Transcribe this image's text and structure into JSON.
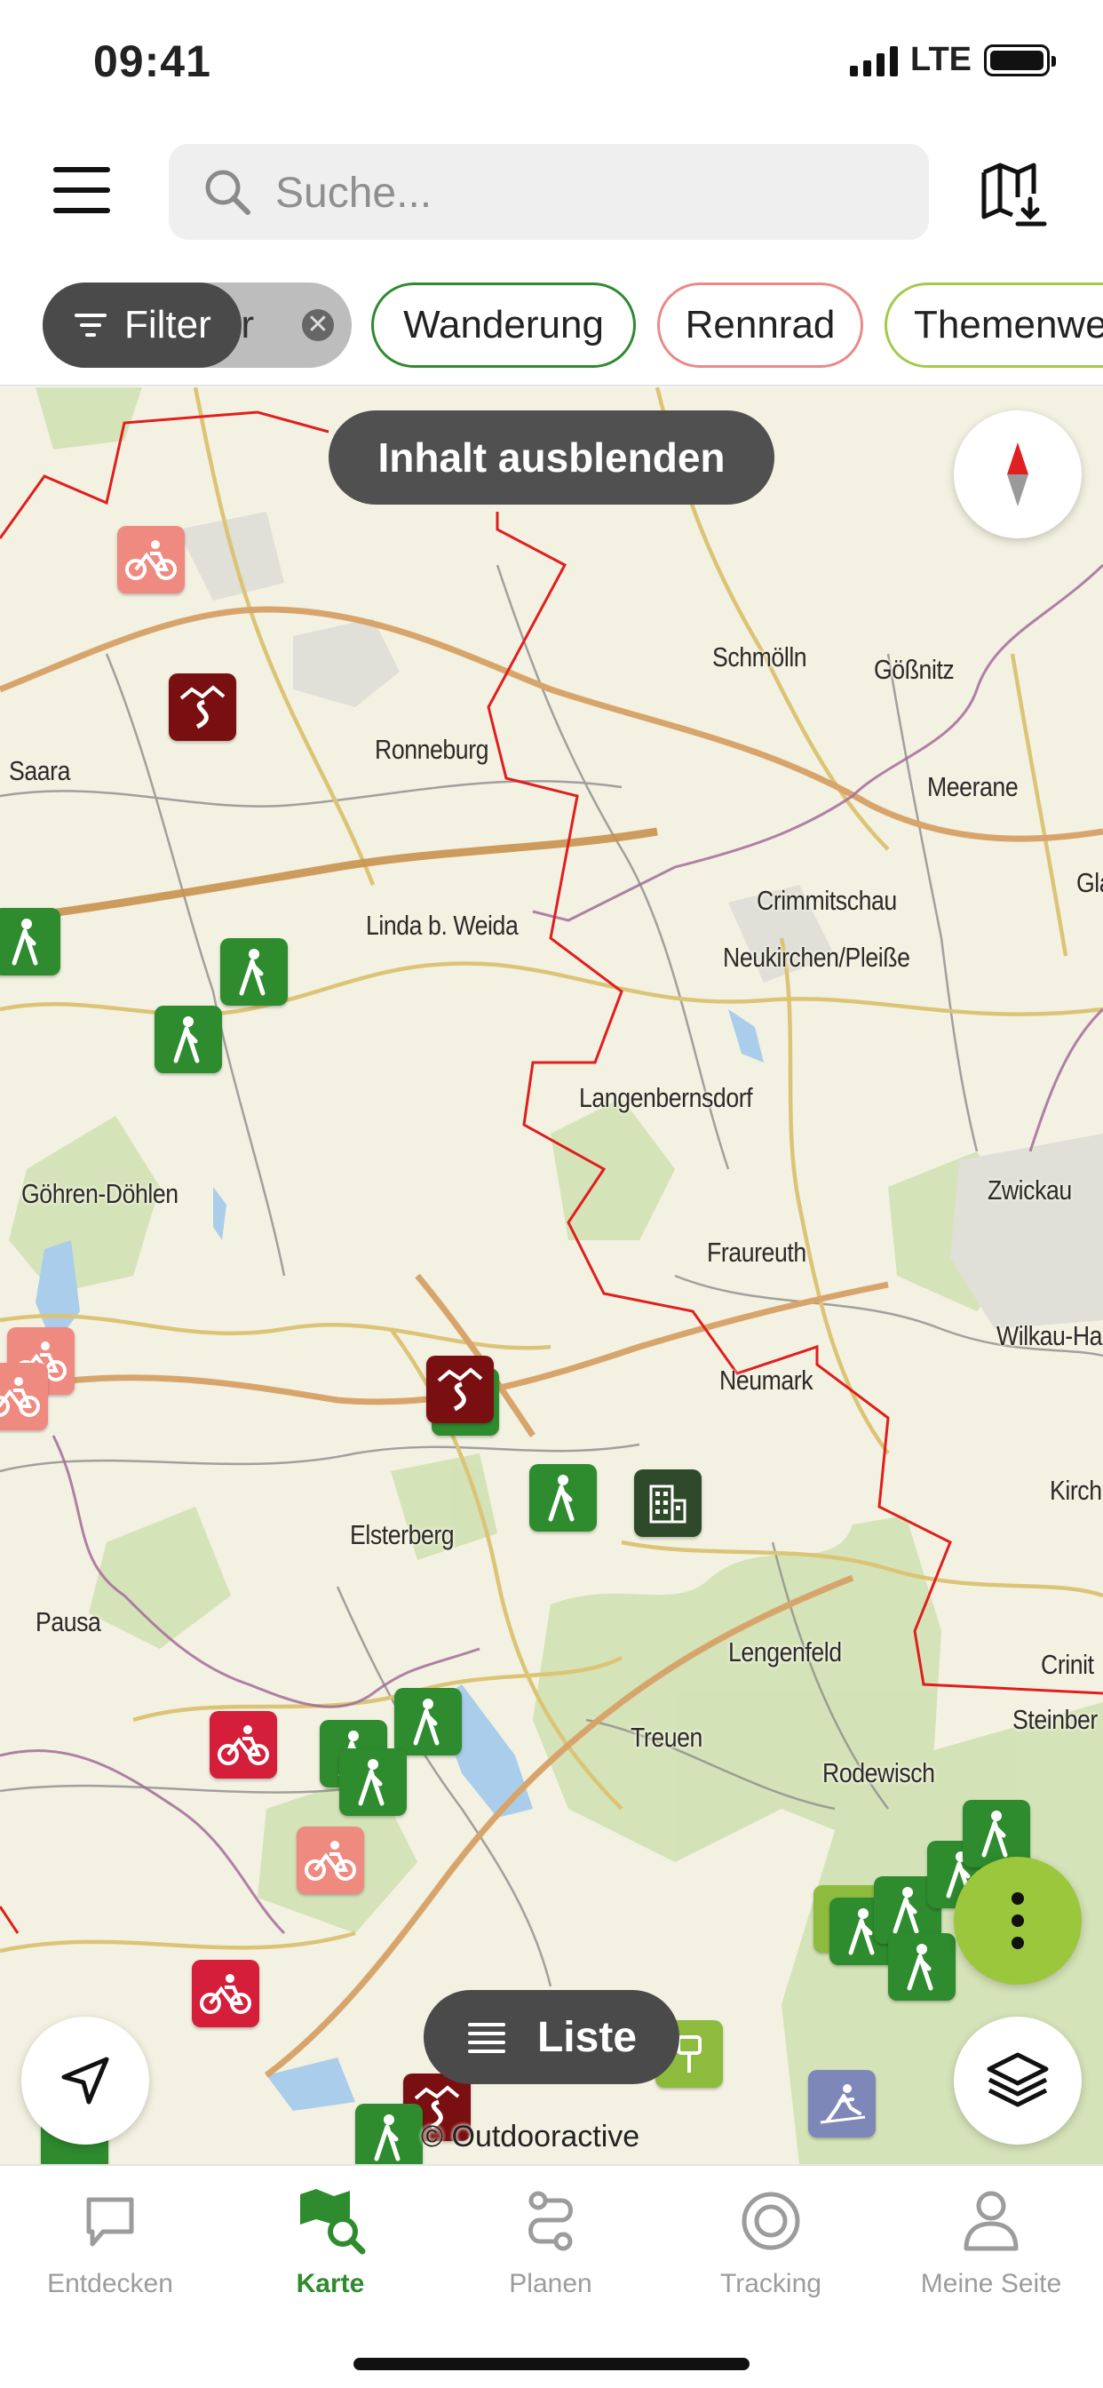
{
  "status_bar": {
    "time": "09:41",
    "network": "LTE"
  },
  "header": {
    "search_placeholder": "Suche..."
  },
  "filters": {
    "filter_label": "Filter",
    "tour_chip_label": "Tour",
    "chips": [
      "Wanderung",
      "Rennrad",
      "Themenwe"
    ]
  },
  "map": {
    "toast": "Inhalt ausblenden",
    "list_button": "Liste",
    "copyright": "© Outdooractive",
    "places": [
      "Schmölln",
      "Gößnitz",
      "Ronneburg",
      "Saara",
      "Meerane",
      "Gla",
      "Crimmitschau",
      "Linda b. Weida",
      "Neukirchen/Pleiße",
      "Langenbernsdorf",
      "Göhren-Döhlen",
      "Zwickau",
      "Fraureuth",
      "Wilkau-Ha",
      "Neumark",
      "Kirch",
      "Elsterberg",
      "Pausa",
      "Lengenfeld",
      "Crinit",
      "Treuen",
      "Steinber",
      "Rodewisch"
    ],
    "markers": {
      "hike": "hiking-marker",
      "bike": "bike-marker",
      "trail": "trail-marker",
      "building": "building-marker"
    }
  },
  "tabbar": {
    "tabs": [
      {
        "label": "Entdecken",
        "icon": "chat-bubble-icon"
      },
      {
        "label": "Karte",
        "icon": "map-search-icon",
        "active": true
      },
      {
        "label": "Planen",
        "icon": "route-plan-icon"
      },
      {
        "label": "Tracking",
        "icon": "record-icon"
      },
      {
        "label": "Meine Seite",
        "icon": "user-icon"
      }
    ]
  },
  "colors": {
    "accent_green": "#2e8b2e",
    "lime": "#9bc73c",
    "route_red": "#e01e1e",
    "map_bg": "#f3f1e1"
  }
}
